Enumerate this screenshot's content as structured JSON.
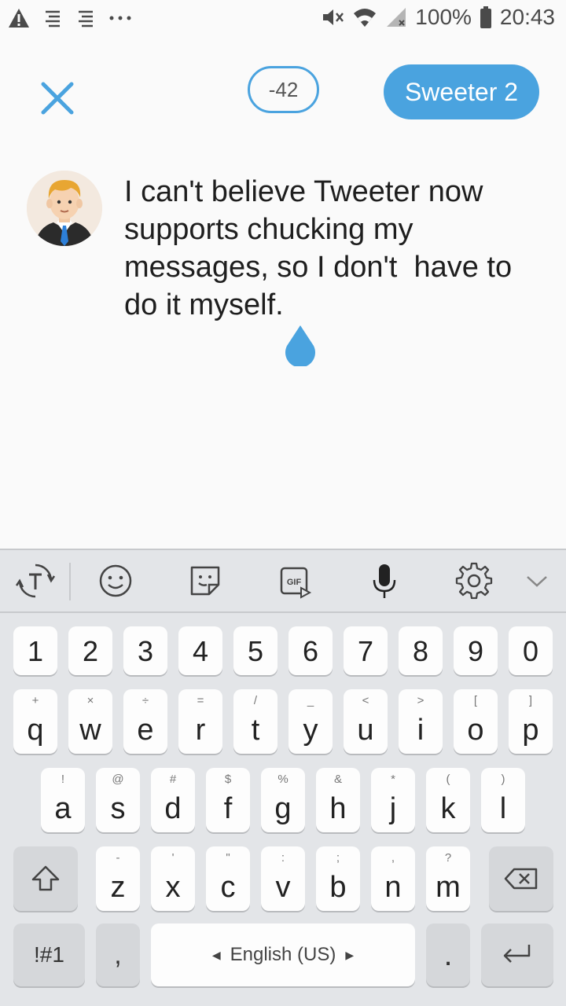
{
  "status_bar": {
    "battery_text": "100%",
    "time": "20:43",
    "icons": [
      "warning-icon",
      "notification-lines-icon",
      "notification-lines-icon",
      "more-dots-icon",
      "mute-icon",
      "wifi-icon",
      "signal-icon",
      "battery-icon"
    ]
  },
  "compose": {
    "char_counter": "-42",
    "send_label": "Sweeter 2",
    "text": "I can't believe Tweeter now supports chucking my messages, so I don't  have to do it myself.",
    "accent_color": "#4aa3df"
  },
  "keyboard": {
    "toolbar_icons": [
      "text-mode-icon",
      "emoji-icon",
      "sticker-icon",
      "gif-icon",
      "microphone-icon",
      "settings-icon",
      "collapse-chevron-icon"
    ],
    "number_row": [
      "1",
      "2",
      "3",
      "4",
      "5",
      "6",
      "7",
      "8",
      "9",
      "0"
    ],
    "row1": [
      {
        "key": "q",
        "sup": "+"
      },
      {
        "key": "w",
        "sup": "×"
      },
      {
        "key": "e",
        "sup": "÷"
      },
      {
        "key": "r",
        "sup": "="
      },
      {
        "key": "t",
        "sup": "/"
      },
      {
        "key": "y",
        "sup": "_"
      },
      {
        "key": "u",
        "sup": "<"
      },
      {
        "key": "i",
        "sup": ">"
      },
      {
        "key": "o",
        "sup": "["
      },
      {
        "key": "p",
        "sup": "]"
      }
    ],
    "row2": [
      {
        "key": "a",
        "sup": "!"
      },
      {
        "key": "s",
        "sup": "@"
      },
      {
        "key": "d",
        "sup": "#"
      },
      {
        "key": "f",
        "sup": "$"
      },
      {
        "key": "g",
        "sup": "%"
      },
      {
        "key": "h",
        "sup": "&"
      },
      {
        "key": "j",
        "sup": "*"
      },
      {
        "key": "k",
        "sup": "("
      },
      {
        "key": "l",
        "sup": ")"
      }
    ],
    "row3": [
      {
        "key": "z",
        "sup": "-"
      },
      {
        "key": "x",
        "sup": "'"
      },
      {
        "key": "c",
        "sup": "\""
      },
      {
        "key": "v",
        "sup": ":"
      },
      {
        "key": "b",
        "sup": ";"
      },
      {
        "key": "n",
        "sup": ","
      },
      {
        "key": "m",
        "sup": "?"
      }
    ],
    "symbols_label": "!#1",
    "comma_label": ",",
    "language_label": "English (US)",
    "period_label": "."
  }
}
